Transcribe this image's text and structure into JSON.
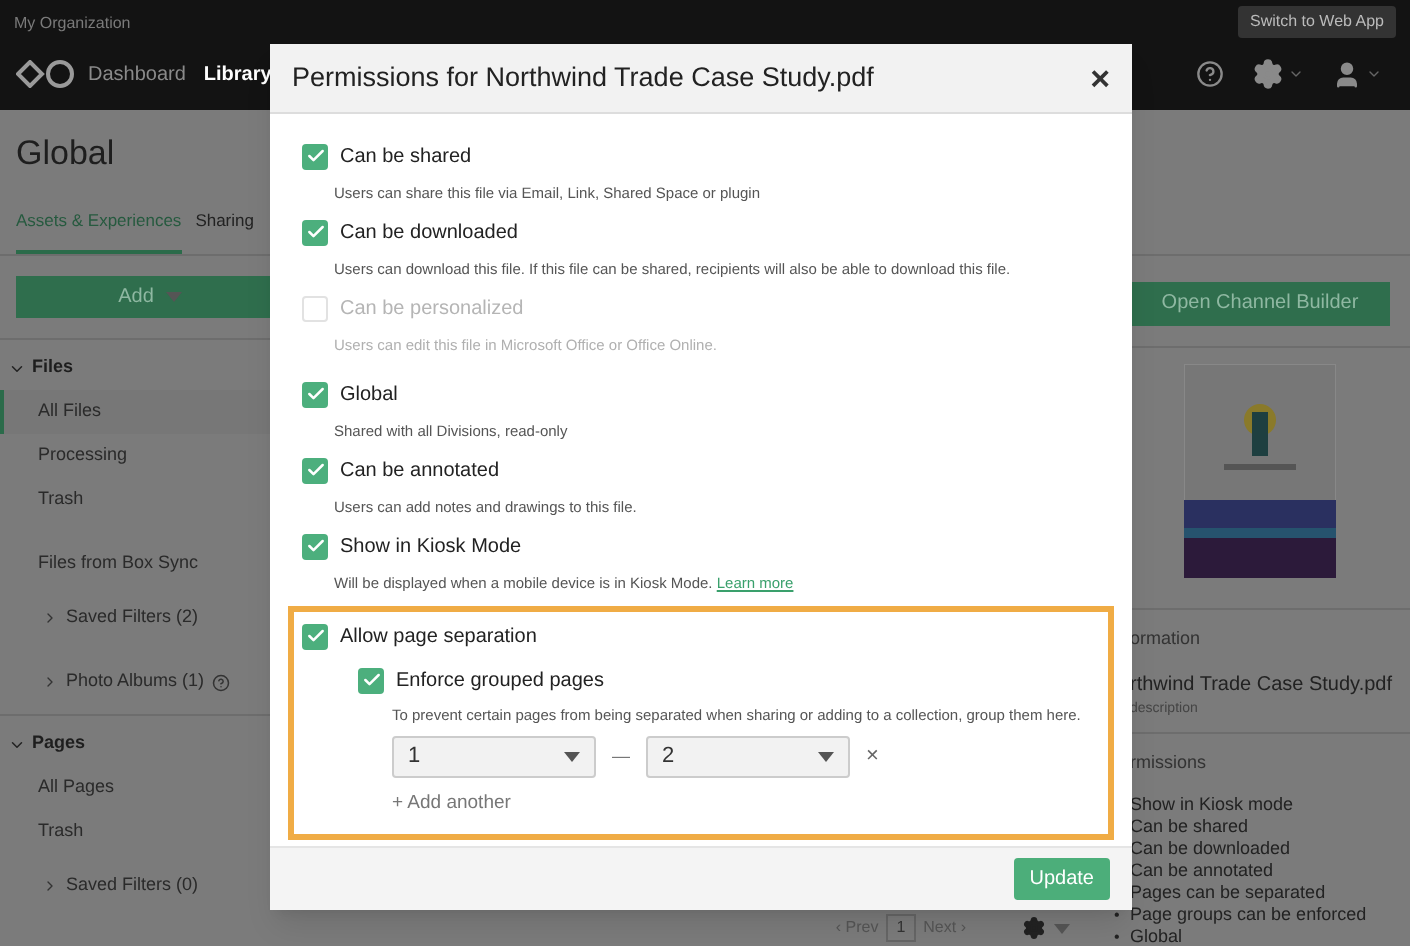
{
  "top_bar": {
    "organization": "My Organization",
    "switch_button": "Switch to Web App",
    "nav": [
      {
        "label": "Dashboard",
        "selected": false
      },
      {
        "label": "Library",
        "selected": true
      }
    ]
  },
  "page": {
    "title": "Global",
    "tabs": [
      {
        "label": "Assets & Experiences",
        "selected": true
      },
      {
        "label": "Sharing",
        "selected": false
      }
    ],
    "add_button": "Add"
  },
  "sidebar": {
    "sections": [
      {
        "title": "Files",
        "expanded": true,
        "items": [
          {
            "label": "All Files",
            "selected": true,
            "kind": "link"
          },
          {
            "label": "Processing",
            "selected": false,
            "kind": "link"
          },
          {
            "label": "Trash",
            "selected": false,
            "kind": "link"
          },
          {
            "label": "Files from Box Sync",
            "selected": false,
            "kind": "link"
          },
          {
            "label": "Saved Filters (2)",
            "selected": false,
            "kind": "folder"
          },
          {
            "label": "Photo Albums (1)",
            "selected": false,
            "kind": "folder-help"
          }
        ]
      },
      {
        "title": "Pages",
        "expanded": true,
        "items": [
          {
            "label": "All Pages",
            "selected": false,
            "kind": "link"
          },
          {
            "label": "Trash",
            "selected": false,
            "kind": "link"
          },
          {
            "label": "Saved Filters (0)",
            "selected": false,
            "kind": "folder"
          }
        ]
      }
    ]
  },
  "right_panel": {
    "channel_button": "Open Channel Builder",
    "information_heading": "ormation",
    "file_name": "rthwind Trade Case Study.pdf",
    "description": "description",
    "permissions_heading": "rmissions",
    "permissions": [
      {
        "text": "Show in Kiosk mode"
      },
      {
        "text": "Can be shared"
      },
      {
        "text": "Can be downloaded"
      },
      {
        "text": "Can be annotated"
      },
      {
        "text": "Pages can be separated"
      },
      {
        "text": "Page groups can be enforced",
        "bullet": "•"
      },
      {
        "text": "Global",
        "bullet": "•"
      }
    ]
  },
  "pager": {
    "prev": "‹ Prev",
    "page": "1",
    "next": "Next ›"
  },
  "dialog": {
    "title": "Permissions for Northwind Trade Case Study.pdf",
    "close": "×",
    "options": [
      {
        "label": "Can be shared",
        "checked": true,
        "disabled": false,
        "description": "Users can share this file via Email, Link, Shared Space or plugin"
      },
      {
        "label": "Can be downloaded",
        "checked": true,
        "disabled": false,
        "description": "Users can download this file. If this file can be shared, recipients will also be able to download this file."
      },
      {
        "label": "Can be personalized",
        "checked": false,
        "disabled": true,
        "description": "Users can edit this file in Microsoft Office or Office Online."
      },
      {
        "label": "Global",
        "checked": true,
        "disabled": false,
        "description": "Shared with all Divisions, read-only"
      },
      {
        "label": "Can be annotated",
        "checked": true,
        "disabled": false,
        "description": "Users can add notes and drawings to this file."
      },
      {
        "label": "Show in Kiosk Mode",
        "checked": true,
        "disabled": false,
        "description": "Will be displayed when a mobile device is in Kiosk Mode.",
        "link": "Learn more"
      }
    ],
    "separation": {
      "label": "Allow page separation",
      "checked": true,
      "highlighted": true,
      "enforce": {
        "label": "Enforce grouped pages",
        "checked": true,
        "description": "To prevent certain pages from being separated when sharing or adding to a collection, group them here.",
        "groups": [
          {
            "from": "1",
            "separator": "—",
            "to": "2",
            "remove": "×"
          }
        ],
        "add_link": "+ Add another"
      }
    },
    "update_button": "Update"
  }
}
